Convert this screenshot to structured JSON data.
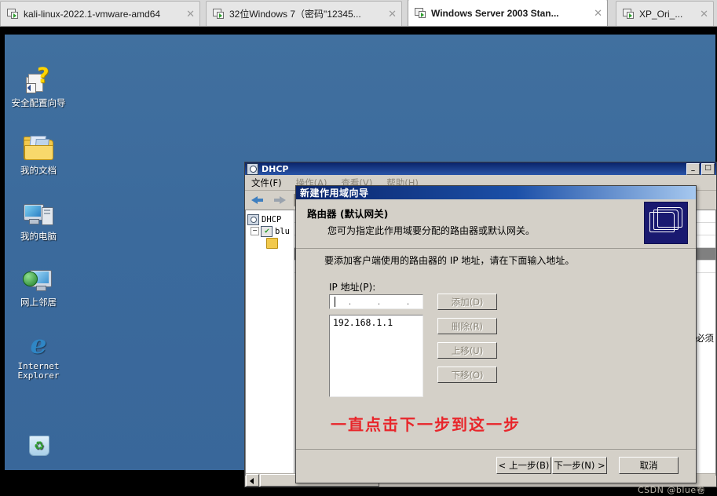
{
  "tabs": [
    {
      "label": "kali-linux-2022.1-vmware-amd64",
      "active": false,
      "close": "✕"
    },
    {
      "label": "32位Windows 7（密码\"12345...",
      "active": false,
      "close": "✕"
    },
    {
      "label": "Windows Server 2003 Stan...",
      "active": true,
      "close": "✕"
    },
    {
      "label": "XP_Ori_...",
      "active": false,
      "close": "✕"
    }
  ],
  "desktop": {
    "icons": [
      {
        "label": "安全配置向导",
        "icon": "security-config-wizard-icon"
      },
      {
        "label": "我的文档",
        "icon": "my-documents-icon"
      },
      {
        "label": "我的电脑",
        "icon": "my-computer-icon"
      },
      {
        "label": "网上邻居",
        "icon": "network-places-icon"
      },
      {
        "label": "Internet Explorer",
        "label_line1": "Internet",
        "label_line2": "Explorer",
        "icon": "internet-explorer-icon"
      },
      {
        "label": "",
        "icon": "recycle-bin-icon"
      }
    ]
  },
  "dhcp_window": {
    "title": "DHCP",
    "window_buttons": {
      "minimize": "_",
      "maximize": "□",
      "close": "✕"
    },
    "menu": [
      {
        "label": "文件(F)"
      },
      {
        "label": "操作(A)"
      },
      {
        "label": "查看(V)"
      },
      {
        "label": "帮助(H)"
      }
    ],
    "toolbar": [
      {
        "name": "back-arrow"
      },
      {
        "name": "forward-arrow"
      }
    ],
    "tree": [
      {
        "label": "DHCP",
        "icon": "dhcp-root-icon",
        "expander": ""
      },
      {
        "label": "blu",
        "icon": "dhcp-server-icon",
        "expander": "−"
      },
      {
        "label": "",
        "icon": "scope-folder-icon",
        "expander": ""
      }
    ],
    "right_pane_text": "必须",
    "scrollbar": {
      "left_arrow": "◀"
    }
  },
  "wizard": {
    "title": "新建作用域向导",
    "header_title": "路由器 (默认网关)",
    "header_subtitle": "您可为指定此作用域要分配的路由器或默认网关。",
    "instruction": "要添加客户端使用的路由器的 IP 地址，请在下面输入地址。",
    "ip_label": "IP 地址(P):",
    "ip_value": "",
    "ip_separators": [
      ".",
      ".",
      "."
    ],
    "list_items": [
      "192.168.1.1"
    ],
    "side_buttons": [
      {
        "label": "添加(D)",
        "enabled": false
      },
      {
        "label": "删除(R)",
        "enabled": false
      },
      {
        "label": "上移(U)",
        "enabled": false
      },
      {
        "label": "下移(O)",
        "enabled": false
      }
    ],
    "annotation": "一直点击下一步到这一步",
    "footer_buttons": [
      {
        "label": "< 上一步(B)"
      },
      {
        "label": "下一步(N) >"
      },
      {
        "label": "取消"
      }
    ]
  },
  "watermark": "CSDN @blue卷",
  "colors": {
    "desktop_blue": "#3a6ea5",
    "titlebar_blue": "#0a246a",
    "dialog_face": "#d4d0c8",
    "annotation_red": "#e8262b"
  }
}
